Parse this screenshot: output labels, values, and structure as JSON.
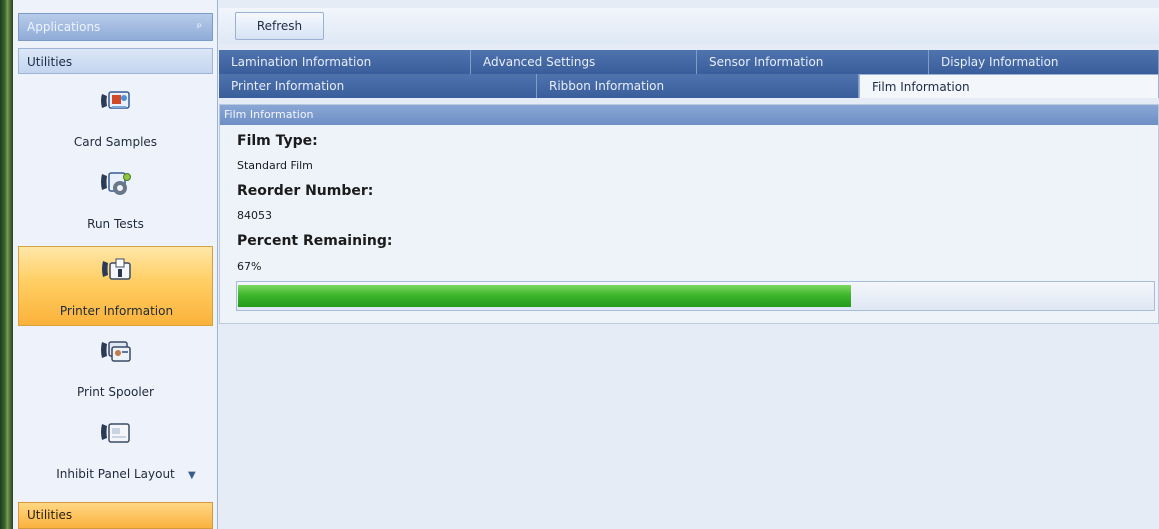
{
  "sidebar": {
    "header": "Applications",
    "section": "Utilities",
    "items": [
      {
        "label": "Card Samples",
        "icon": "card-samples-icon"
      },
      {
        "label": "Run Tests",
        "icon": "run-tests-icon"
      },
      {
        "label": "Printer Information",
        "icon": "printer-information-icon",
        "active": true
      },
      {
        "label": "Print Spooler",
        "icon": "print-spooler-icon"
      },
      {
        "label": "Inhibit Panel Layout",
        "icon": "inhibit-panel-layout-icon"
      }
    ],
    "footer": "Utilities"
  },
  "toolbar": {
    "refresh_label": "Refresh"
  },
  "tabs": {
    "row1": [
      {
        "label": "Lamination Information"
      },
      {
        "label": "Advanced Settings"
      },
      {
        "label": "Sensor Information"
      },
      {
        "label": "Display Information"
      }
    ],
    "row2": [
      {
        "label": "Printer Information"
      },
      {
        "label": "Ribbon Information"
      },
      {
        "label": "Film Information",
        "selected": true
      }
    ]
  },
  "panel": {
    "title": "Film Information",
    "film_type_label": "Film Type:",
    "film_type_value": "Standard Film",
    "reorder_label": "Reorder Number:",
    "reorder_value": "84053",
    "percent_label": "Percent Remaining:",
    "percent_value": "67%",
    "progress_fraction": 0.67
  },
  "colors": {
    "accent": "#3a5e9b",
    "active_item": "#fbb23b",
    "progress": "#3fb62d"
  }
}
